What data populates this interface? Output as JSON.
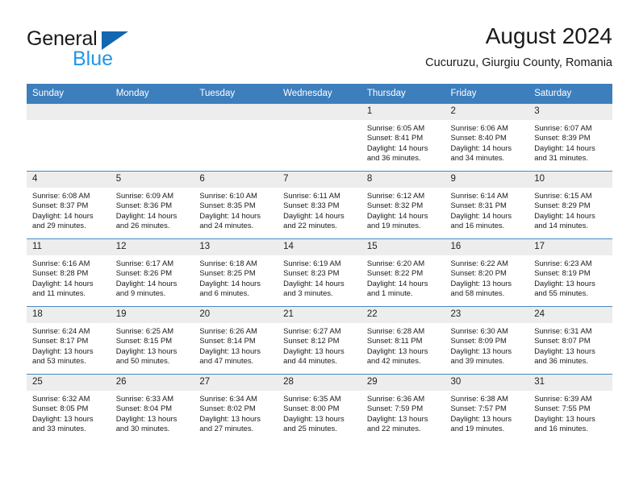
{
  "logo": {
    "word_one": "General",
    "word_two": "Blue",
    "triangle_color": "#1367b0",
    "blue_color": "#2196e8"
  },
  "header": {
    "title": "August 2024",
    "subtitle": "Cucuruzu, Giurgiu County, Romania"
  },
  "theme": {
    "header_row_bg": "#3d7ebd",
    "daynum_bg": "#ededed",
    "grid_line": "#4a87c4",
    "text": "#1a1a1a"
  },
  "calendar": {
    "weekday_headers": [
      "Sunday",
      "Monday",
      "Tuesday",
      "Wednesday",
      "Thursday",
      "Friday",
      "Saturday"
    ],
    "labels": {
      "sunrise": "Sunrise:",
      "sunset": "Sunset:",
      "daylight": "Daylight:"
    },
    "weeks": [
      [
        {
          "day": "",
          "empty": true
        },
        {
          "day": "",
          "empty": true
        },
        {
          "day": "",
          "empty": true
        },
        {
          "day": "",
          "empty": true
        },
        {
          "day": "1",
          "sunrise": "Sunrise: 6:05 AM",
          "sunset": "Sunset: 8:41 PM",
          "daylight_1": "Daylight: 14 hours",
          "daylight_2": "and 36 minutes."
        },
        {
          "day": "2",
          "sunrise": "Sunrise: 6:06 AM",
          "sunset": "Sunset: 8:40 PM",
          "daylight_1": "Daylight: 14 hours",
          "daylight_2": "and 34 minutes."
        },
        {
          "day": "3",
          "sunrise": "Sunrise: 6:07 AM",
          "sunset": "Sunset: 8:39 PM",
          "daylight_1": "Daylight: 14 hours",
          "daylight_2": "and 31 minutes."
        }
      ],
      [
        {
          "day": "4",
          "sunrise": "Sunrise: 6:08 AM",
          "sunset": "Sunset: 8:37 PM",
          "daylight_1": "Daylight: 14 hours",
          "daylight_2": "and 29 minutes."
        },
        {
          "day": "5",
          "sunrise": "Sunrise: 6:09 AM",
          "sunset": "Sunset: 8:36 PM",
          "daylight_1": "Daylight: 14 hours",
          "daylight_2": "and 26 minutes."
        },
        {
          "day": "6",
          "sunrise": "Sunrise: 6:10 AM",
          "sunset": "Sunset: 8:35 PM",
          "daylight_1": "Daylight: 14 hours",
          "daylight_2": "and 24 minutes."
        },
        {
          "day": "7",
          "sunrise": "Sunrise: 6:11 AM",
          "sunset": "Sunset: 8:33 PM",
          "daylight_1": "Daylight: 14 hours",
          "daylight_2": "and 22 minutes."
        },
        {
          "day": "8",
          "sunrise": "Sunrise: 6:12 AM",
          "sunset": "Sunset: 8:32 PM",
          "daylight_1": "Daylight: 14 hours",
          "daylight_2": "and 19 minutes."
        },
        {
          "day": "9",
          "sunrise": "Sunrise: 6:14 AM",
          "sunset": "Sunset: 8:31 PM",
          "daylight_1": "Daylight: 14 hours",
          "daylight_2": "and 16 minutes."
        },
        {
          "day": "10",
          "sunrise": "Sunrise: 6:15 AM",
          "sunset": "Sunset: 8:29 PM",
          "daylight_1": "Daylight: 14 hours",
          "daylight_2": "and 14 minutes."
        }
      ],
      [
        {
          "day": "11",
          "sunrise": "Sunrise: 6:16 AM",
          "sunset": "Sunset: 8:28 PM",
          "daylight_1": "Daylight: 14 hours",
          "daylight_2": "and 11 minutes."
        },
        {
          "day": "12",
          "sunrise": "Sunrise: 6:17 AM",
          "sunset": "Sunset: 8:26 PM",
          "daylight_1": "Daylight: 14 hours",
          "daylight_2": "and 9 minutes."
        },
        {
          "day": "13",
          "sunrise": "Sunrise: 6:18 AM",
          "sunset": "Sunset: 8:25 PM",
          "daylight_1": "Daylight: 14 hours",
          "daylight_2": "and 6 minutes."
        },
        {
          "day": "14",
          "sunrise": "Sunrise: 6:19 AM",
          "sunset": "Sunset: 8:23 PM",
          "daylight_1": "Daylight: 14 hours",
          "daylight_2": "and 3 minutes."
        },
        {
          "day": "15",
          "sunrise": "Sunrise: 6:20 AM",
          "sunset": "Sunset: 8:22 PM",
          "daylight_1": "Daylight: 14 hours",
          "daylight_2": "and 1 minute."
        },
        {
          "day": "16",
          "sunrise": "Sunrise: 6:22 AM",
          "sunset": "Sunset: 8:20 PM",
          "daylight_1": "Daylight: 13 hours",
          "daylight_2": "and 58 minutes."
        },
        {
          "day": "17",
          "sunrise": "Sunrise: 6:23 AM",
          "sunset": "Sunset: 8:19 PM",
          "daylight_1": "Daylight: 13 hours",
          "daylight_2": "and 55 minutes."
        }
      ],
      [
        {
          "day": "18",
          "sunrise": "Sunrise: 6:24 AM",
          "sunset": "Sunset: 8:17 PM",
          "daylight_1": "Daylight: 13 hours",
          "daylight_2": "and 53 minutes."
        },
        {
          "day": "19",
          "sunrise": "Sunrise: 6:25 AM",
          "sunset": "Sunset: 8:15 PM",
          "daylight_1": "Daylight: 13 hours",
          "daylight_2": "and 50 minutes."
        },
        {
          "day": "20",
          "sunrise": "Sunrise: 6:26 AM",
          "sunset": "Sunset: 8:14 PM",
          "daylight_1": "Daylight: 13 hours",
          "daylight_2": "and 47 minutes."
        },
        {
          "day": "21",
          "sunrise": "Sunrise: 6:27 AM",
          "sunset": "Sunset: 8:12 PM",
          "daylight_1": "Daylight: 13 hours",
          "daylight_2": "and 44 minutes."
        },
        {
          "day": "22",
          "sunrise": "Sunrise: 6:28 AM",
          "sunset": "Sunset: 8:11 PM",
          "daylight_1": "Daylight: 13 hours",
          "daylight_2": "and 42 minutes."
        },
        {
          "day": "23",
          "sunrise": "Sunrise: 6:30 AM",
          "sunset": "Sunset: 8:09 PM",
          "daylight_1": "Daylight: 13 hours",
          "daylight_2": "and 39 minutes."
        },
        {
          "day": "24",
          "sunrise": "Sunrise: 6:31 AM",
          "sunset": "Sunset: 8:07 PM",
          "daylight_1": "Daylight: 13 hours",
          "daylight_2": "and 36 minutes."
        }
      ],
      [
        {
          "day": "25",
          "sunrise": "Sunrise: 6:32 AM",
          "sunset": "Sunset: 8:05 PM",
          "daylight_1": "Daylight: 13 hours",
          "daylight_2": "and 33 minutes."
        },
        {
          "day": "26",
          "sunrise": "Sunrise: 6:33 AM",
          "sunset": "Sunset: 8:04 PM",
          "daylight_1": "Daylight: 13 hours",
          "daylight_2": "and 30 minutes."
        },
        {
          "day": "27",
          "sunrise": "Sunrise: 6:34 AM",
          "sunset": "Sunset: 8:02 PM",
          "daylight_1": "Daylight: 13 hours",
          "daylight_2": "and 27 minutes."
        },
        {
          "day": "28",
          "sunrise": "Sunrise: 6:35 AM",
          "sunset": "Sunset: 8:00 PM",
          "daylight_1": "Daylight: 13 hours",
          "daylight_2": "and 25 minutes."
        },
        {
          "day": "29",
          "sunrise": "Sunrise: 6:36 AM",
          "sunset": "Sunset: 7:59 PM",
          "daylight_1": "Daylight: 13 hours",
          "daylight_2": "and 22 minutes."
        },
        {
          "day": "30",
          "sunrise": "Sunrise: 6:38 AM",
          "sunset": "Sunset: 7:57 PM",
          "daylight_1": "Daylight: 13 hours",
          "daylight_2": "and 19 minutes."
        },
        {
          "day": "31",
          "sunrise": "Sunrise: 6:39 AM",
          "sunset": "Sunset: 7:55 PM",
          "daylight_1": "Daylight: 13 hours",
          "daylight_2": "and 16 minutes."
        }
      ]
    ]
  }
}
